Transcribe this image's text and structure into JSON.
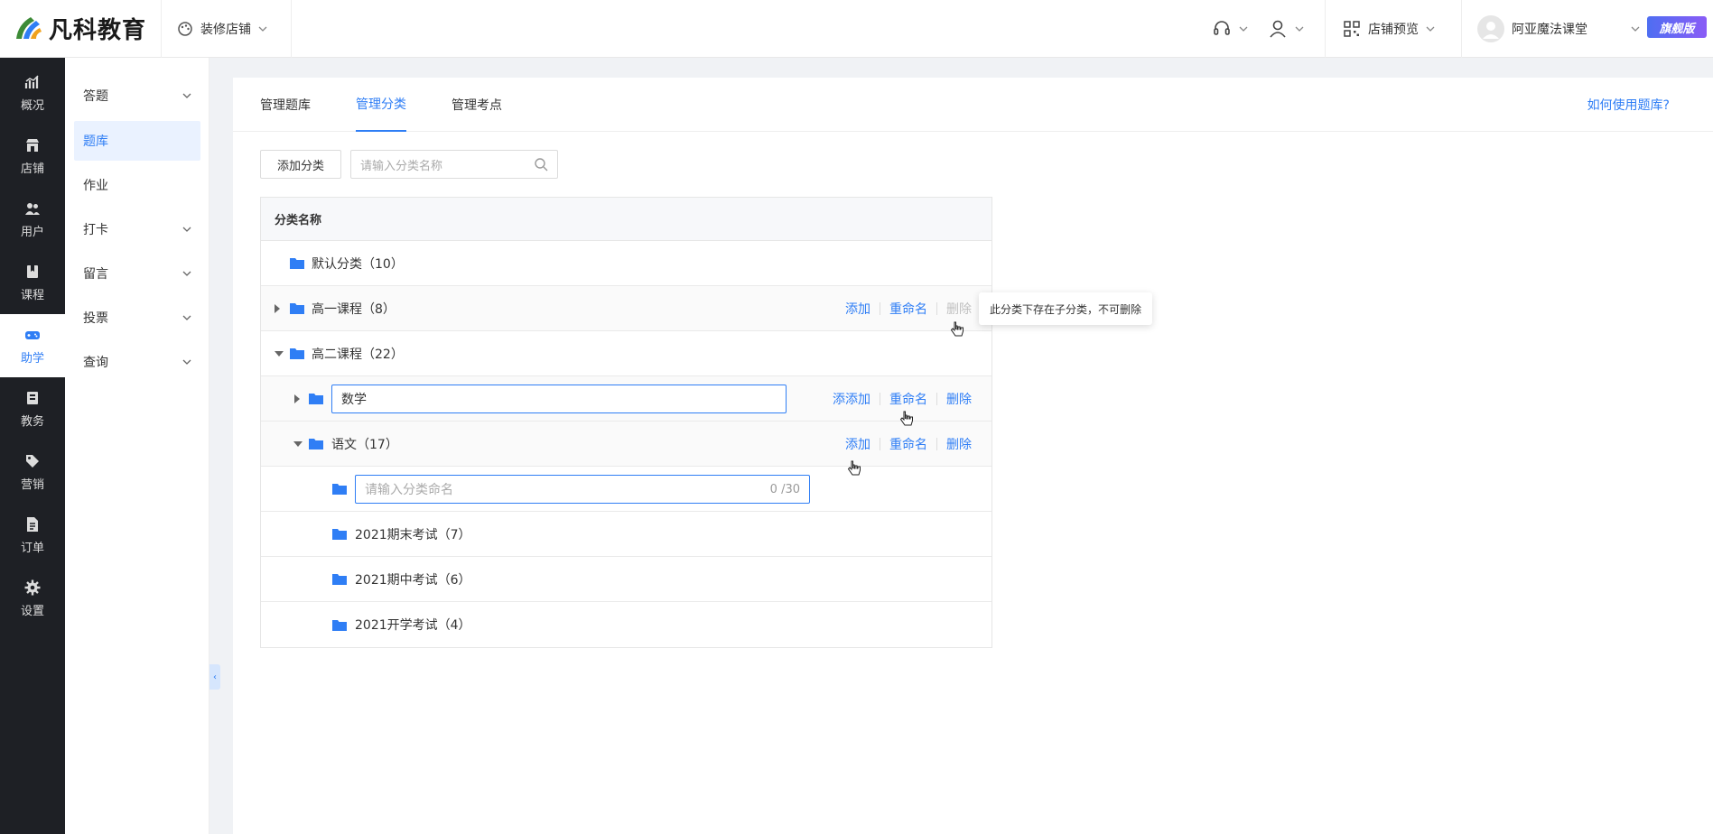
{
  "brand": {
    "name": "凡科教育",
    "colors": {
      "accent": "#2f7ef5",
      "sidebar_bg": "#1e2025"
    }
  },
  "header": {
    "store_decor": "装修店铺",
    "store_preview": "店铺预览",
    "username": "阿亚魔法课堂",
    "badge": "旗舰版",
    "icons": [
      "headset-icon",
      "user-icon",
      "qrcode-icon",
      "avatar"
    ]
  },
  "sidebar": {
    "items": [
      {
        "label": "概况",
        "icon": "chart-icon"
      },
      {
        "label": "店铺",
        "icon": "store-icon"
      },
      {
        "label": "用户",
        "icon": "users-icon"
      },
      {
        "label": "课程",
        "icon": "book-icon"
      },
      {
        "label": "助学",
        "icon": "gamepad-icon"
      },
      {
        "label": "教务",
        "icon": "notebook-icon"
      },
      {
        "label": "营销",
        "icon": "tag-icon"
      },
      {
        "label": "订单",
        "icon": "order-icon"
      },
      {
        "label": "设置",
        "icon": "gear-icon"
      }
    ]
  },
  "subnav": {
    "items": [
      {
        "label": "答题"
      },
      {
        "label": "题库"
      },
      {
        "label": "作业"
      },
      {
        "label": "打卡"
      },
      {
        "label": "留言"
      },
      {
        "label": "投票"
      },
      {
        "label": "查询"
      }
    ],
    "collapse_glyph": "‹"
  },
  "tabs": {
    "bank": "管理题库",
    "category": "管理分类",
    "points": "管理考点"
  },
  "help_link": "如何使用题库?",
  "toolbar": {
    "add_label": "添加分类",
    "search_placeholder": "请输入分类名称"
  },
  "table": {
    "header": "分类名称",
    "rows": [
      {
        "label": "默认分类（10）"
      },
      {
        "label": "高一课程（8）"
      },
      {
        "label": "高二课程（22）"
      },
      {
        "label": "数学"
      },
      {
        "label": "语文（17）"
      },
      {
        "placeholder": "请输入分类命名",
        "counter": "0 /30"
      },
      {
        "label": "2021期末考试（7）"
      },
      {
        "label": "2021期中考试（6）"
      },
      {
        "label": "2021开学考试（4）"
      }
    ],
    "actions": {
      "add": "添加",
      "rename": "重命名",
      "delete": "删除"
    },
    "math_add_overlap": "添添加"
  },
  "tooltip": "此分类下存在子分类，不可删除"
}
